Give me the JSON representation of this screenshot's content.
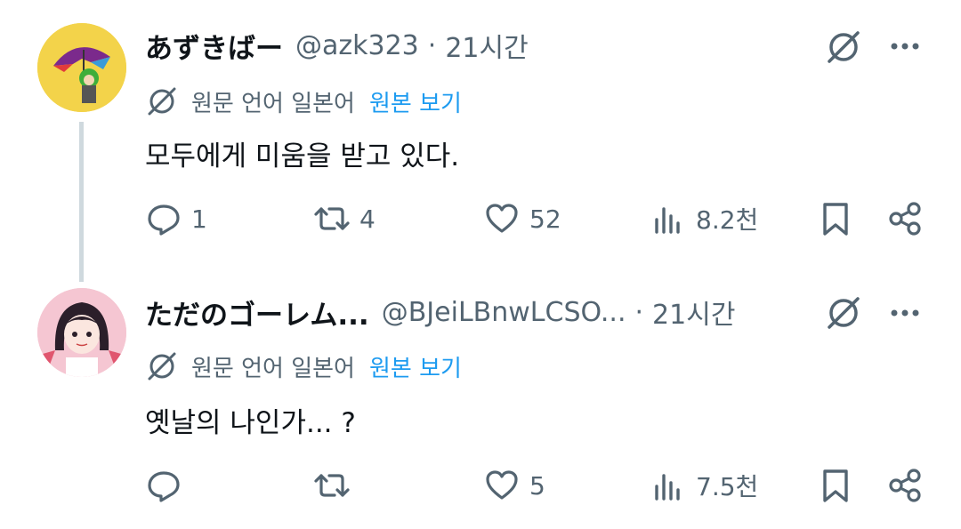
{
  "tweets": [
    {
      "display_name": "あずきばー",
      "handle": "@azk323",
      "separator": "·",
      "time": "21시간",
      "translation_note": "원문 언어 일본어",
      "show_original": "원본 보기",
      "text": "모두에게 미움을 받고 있다.",
      "counts": {
        "replies": "1",
        "retweets": "4",
        "likes": "52",
        "views": "8.2천"
      },
      "avatar_colors": {
        "bg": "#f3d34a",
        "umbrella": "#7b2a8c",
        "hair": "#3fae3a"
      }
    },
    {
      "display_name": "ただのゴーレム...",
      "handle": "@BJeiLBnwLCSO...",
      "separator": "·",
      "time": "21시간",
      "translation_note": "원문 언어 일본어",
      "show_original": "원본 보기",
      "text": "옛날의 나인가... ?",
      "counts": {
        "replies": "",
        "retweets": "",
        "likes": "5",
        "views": "7.5천"
      },
      "avatar_colors": {
        "bg": "#f5c6d2",
        "hair": "#2b1f2a",
        "accent": "#e0566f"
      }
    }
  ],
  "icons": {
    "grok": "grok-icon",
    "more": "more-icon",
    "translate": "translate-icon",
    "reply": "reply-icon",
    "retweet": "retweet-icon",
    "like": "like-icon",
    "views": "views-icon",
    "bookmark": "bookmark-icon",
    "share": "share-icon"
  },
  "colors": {
    "text": "#0f1419",
    "secondary": "#536471",
    "link": "#1d9bf0",
    "thread": "#cfd9de"
  }
}
